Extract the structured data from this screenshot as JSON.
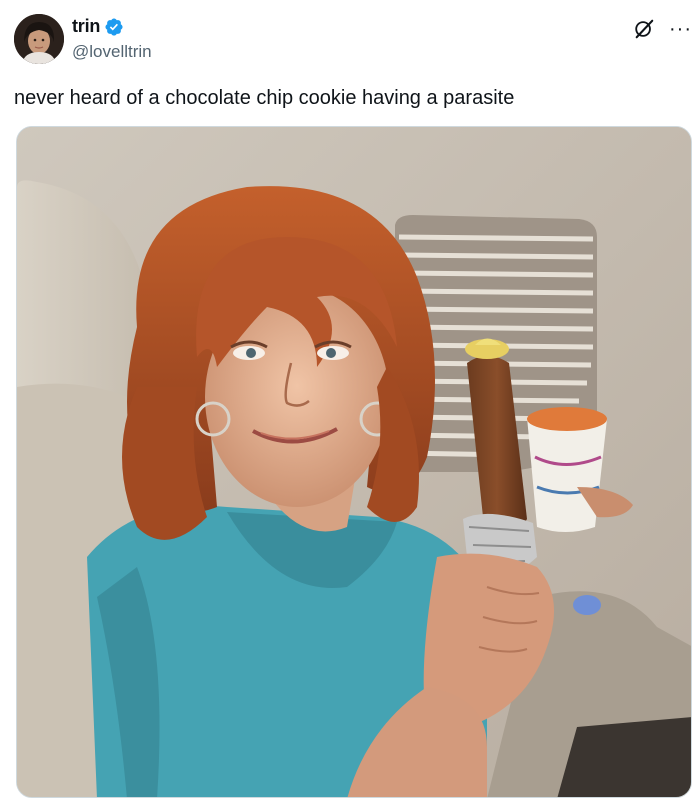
{
  "author": {
    "display_name": "trin",
    "handle": "@lovelltrin",
    "verified": true,
    "verified_icon": "verified-badge-icon",
    "verified_color": "#1d9bf0"
  },
  "tweet": {
    "text": "never heard of a chocolate chip cookie having a parasite"
  },
  "actions": {
    "grok_icon": "grok-icon",
    "more_icon": "more-options-icon",
    "more_label": "···"
  },
  "media": {
    "type": "photo",
    "icon": "photo-icon"
  },
  "colors": {
    "text": "#0f1419",
    "secondary_text": "#536471",
    "border": "#cfd9de",
    "background": "#ffffff"
  }
}
